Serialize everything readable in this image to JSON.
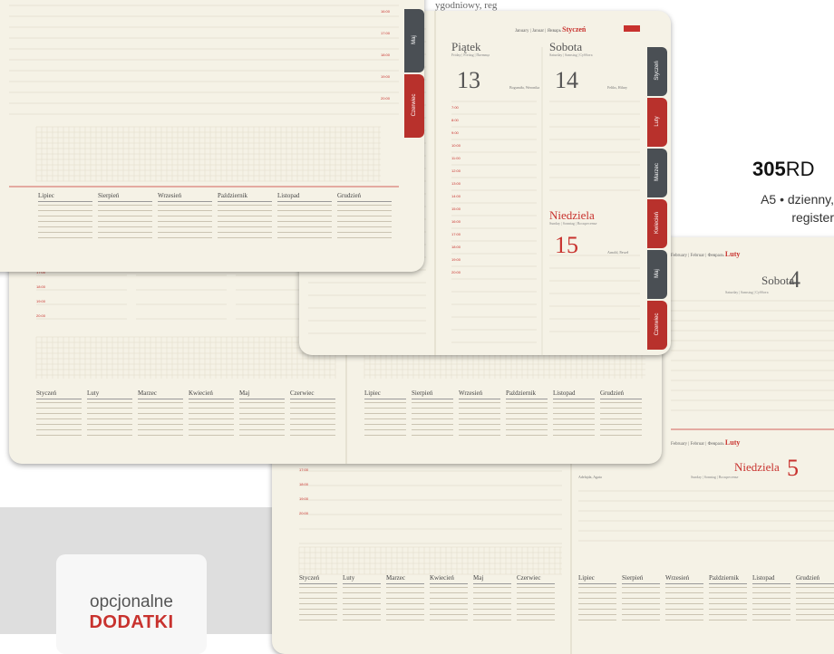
{
  "top_partial_text": "ygodniowy, reg",
  "product": {
    "code_bold": "305",
    "code_rest": "RD",
    "desc_line1": "A5 • dzienny,",
    "desc_line2": "register"
  },
  "addons": {
    "line1": "opcjonalne",
    "line2": "DODATKI"
  },
  "colors": {
    "paper": "#f5f2e6",
    "accent": "#c8322e",
    "tab_dark": "#4a4f54",
    "tab_red": "#b8312c"
  },
  "planner_front": {
    "header_months": "January | Januar | Январь",
    "header_month_pl": "Styczeń",
    "friday": {
      "name": "Piątek",
      "sub": "Friday | Freitag | Пятница",
      "number": "13",
      "saint": "Bogumiła, Weronika"
    },
    "saturday": {
      "name": "Sobota",
      "sub": "Saturday | Samstag | Суббота",
      "number": "14",
      "saint": "Feliks, Hilary"
    },
    "sunday": {
      "name": "Niedziela",
      "sub": "Sunday | Sonntag | Воскресенье",
      "number": "15",
      "saint": "Arnold, Paweł"
    },
    "hours": [
      "7:00",
      "8:00",
      "9:00",
      "10:00",
      "11:00",
      "12:00",
      "13:00",
      "14:00",
      "15:00",
      "16:00",
      "17:00",
      "18:00",
      "19:00",
      "20:00"
    ],
    "tabs": [
      "Styczeń",
      "Luty",
      "Marzec",
      "Kwiecień",
      "Maj",
      "Czerwiec"
    ]
  },
  "planner_top": {
    "hours": [
      "16:00",
      "17:00",
      "18:00",
      "19:00",
      "20:00"
    ],
    "tabs": [
      "Maj",
      "Czerwiec"
    ],
    "months": [
      "Lipiec",
      "Sierpień",
      "Wrzesień",
      "Październik",
      "Listopad",
      "Grudzień"
    ]
  },
  "planner_left_lower": {
    "hours": [
      "17:00",
      "18:00",
      "19:00",
      "20:00"
    ],
    "months": [
      "Styczeń",
      "Luty",
      "Marzec",
      "Kwiecień",
      "Maj",
      "Czerwiec"
    ],
    "months_right": [
      "Lipiec",
      "Sierpień",
      "Wrzesień",
      "Październik",
      "Listopad",
      "Grudzień"
    ]
  },
  "planner_right": {
    "header_months": "February | Februar | Февраль",
    "header_month_pl": "Luty",
    "saturday": {
      "name": "Sobota",
      "sub": "Saturday | Samstag | Суббота",
      "number": "4"
    },
    "sunday": {
      "name": "Niedziela",
      "sub": "Sunday | Sonntag | Воскресенье",
      "number": "5",
      "saint": "Adelajda, Agata"
    },
    "hours": [
      "17:00",
      "18:00",
      "19:00",
      "20:00"
    ],
    "months_left": [
      "Styczeń",
      "Luty",
      "Marzec",
      "Kwiecień",
      "Maj",
      "Czerwiec"
    ],
    "months_right": [
      "Lipiec",
      "Sierpień",
      "Wrzesień",
      "Październik",
      "Listopad",
      "Grudzień"
    ]
  },
  "weekday_abbr": [
    "pn",
    "wt",
    "śr",
    "cz",
    "pt",
    "so",
    "nd"
  ]
}
